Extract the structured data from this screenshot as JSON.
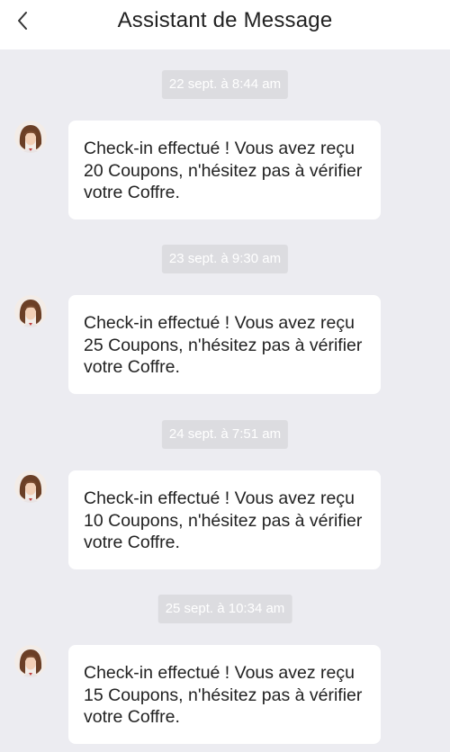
{
  "header": {
    "title": "Assistant de Message",
    "back_icon": "chevron-left-icon"
  },
  "avatar_icon": "assistant-avatar-icon",
  "colors": {
    "background": "#ececf1",
    "header": "#ffffff",
    "bubble": "#ffffff",
    "time_pill": "#dcdce0",
    "text": "#222222"
  },
  "messages": [
    {
      "time": "22 sept. à 8:44 am",
      "text": "Check-in effectué ! Vous avez reçu 20 Coupons, n'hésitez pas à vérifier votre Coffre."
    },
    {
      "time": "23 sept. à 9:30 am",
      "text": "Check-in effectué ! Vous avez reçu 25 Coupons, n'hésitez pas à vérifier votre Coffre."
    },
    {
      "time": "24 sept. à 7:51 am",
      "text": "Check-in effectué ! Vous avez reçu 10 Coupons, n'hésitez pas à vérifier votre Coffre."
    },
    {
      "time": "25 sept. à 10:34 am",
      "text": "Check-in effectué ! Vous avez reçu 15 Coupons, n'hésitez pas à vérifier votre Coffre."
    }
  ]
}
